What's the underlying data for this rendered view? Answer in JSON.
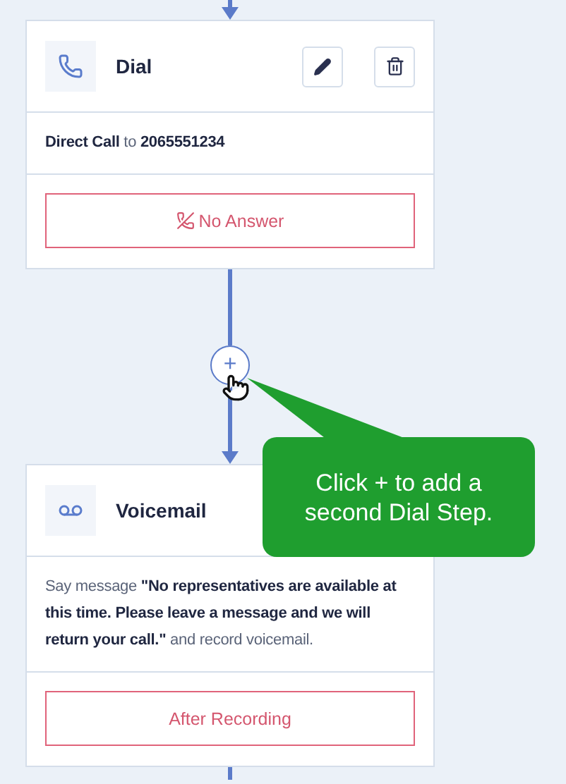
{
  "steps": [
    {
      "kind": "dial",
      "title": "Dial",
      "description": "**Direct Call** to **2065551234**",
      "outcome": {
        "label": "No Answer"
      }
    },
    {
      "kind": "voicemail",
      "title": "Voicemail",
      "description": "Say message **\"No representatives are available at this time. Please leave a message and we will return your call.\"** and record voicemail.",
      "outcome": {
        "label": "After Recording"
      }
    }
  ],
  "add_button": {
    "label": "+"
  },
  "tooltip": {
    "text": "Click + to add a second Dial Step."
  }
}
